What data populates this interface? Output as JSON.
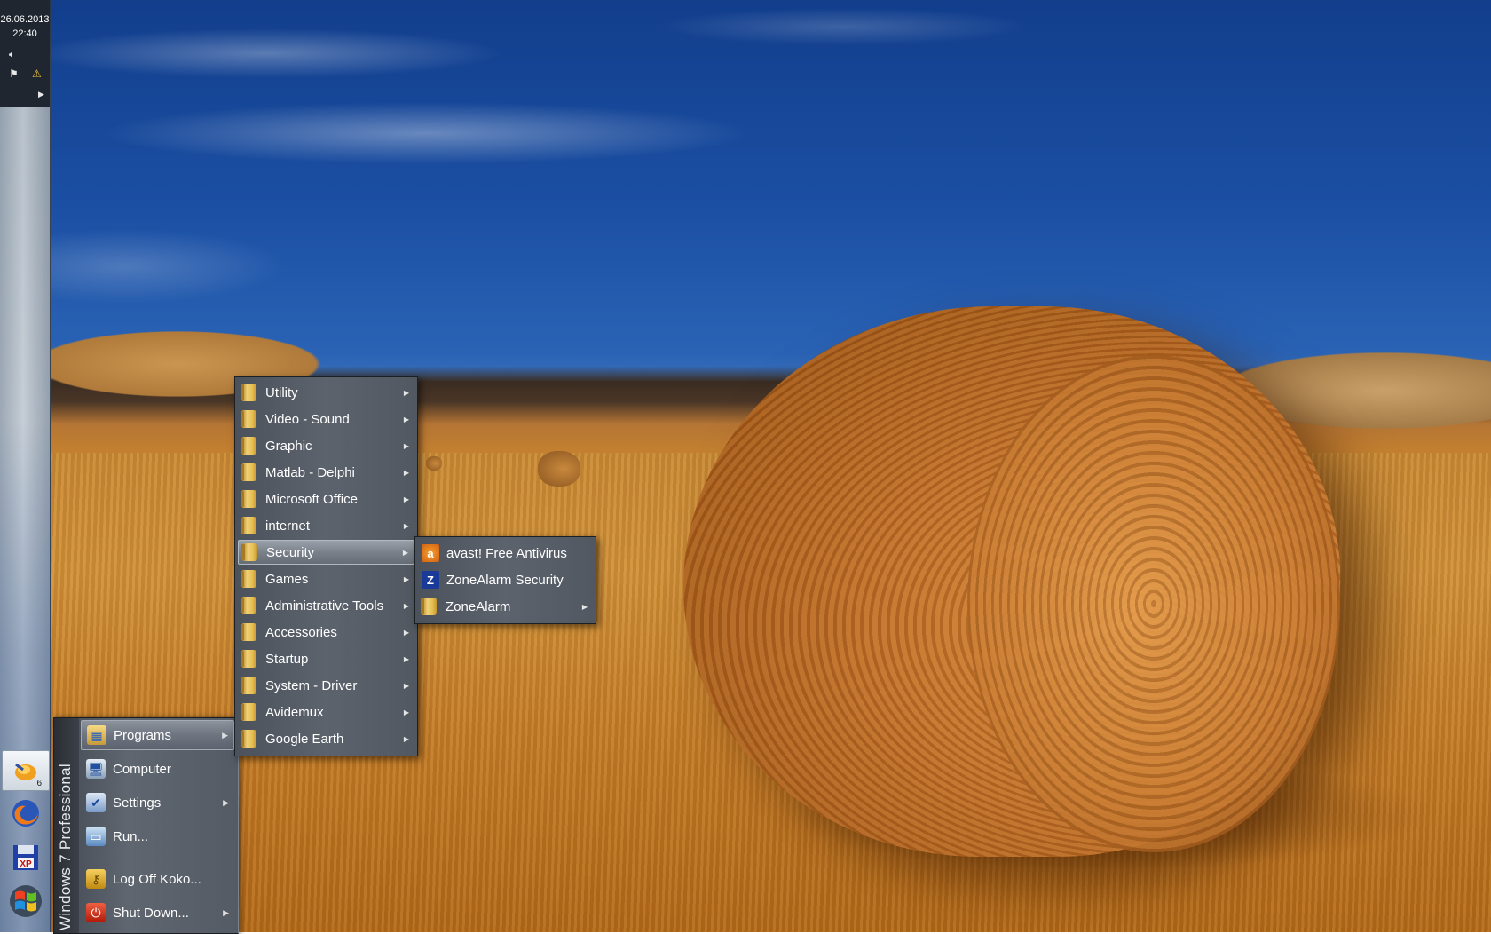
{
  "tray": {
    "date": "26.06.2013",
    "time": "22:40"
  },
  "taskbar": {
    "launcher_badge": "6",
    "buttons": [
      {
        "icon": "file-manager-icon",
        "badge": "6",
        "active": true
      },
      {
        "icon": "firefox-icon"
      },
      {
        "icon": "xp-mode-icon"
      },
      {
        "icon": "windows-logo-icon"
      }
    ]
  },
  "start_menu": {
    "brand": "Windows 7 Professional",
    "items": [
      {
        "label": "Programs",
        "icon": "programs-folder-icon",
        "has_submenu": true,
        "active": true
      },
      {
        "label": "Computer",
        "icon": "computer-icon",
        "has_submenu": false
      },
      {
        "label": "Settings",
        "icon": "settings-icon",
        "has_submenu": true
      },
      {
        "label": "Run...",
        "icon": "run-icon",
        "has_submenu": false
      },
      {
        "label": "Log Off Koko...",
        "icon": "key-icon",
        "has_submenu": false
      },
      {
        "label": "Shut Down...",
        "icon": "power-icon",
        "has_submenu": true
      }
    ]
  },
  "programs_menu": {
    "items": [
      "Utility",
      "Video - Sound",
      "Graphic",
      "Matlab - Delphi",
      "Microsoft Office",
      "internet",
      "Security",
      "Games",
      "Administrative Tools",
      "Accessories",
      "Startup",
      "System - Driver",
      "Avidemux",
      "Google Earth"
    ],
    "active": "Security"
  },
  "security_menu": {
    "items": [
      {
        "label": "avast! Free Antivirus",
        "icon": "avast-icon",
        "has_submenu": false
      },
      {
        "label": "ZoneAlarm Security",
        "icon": "zonealarm-icon",
        "has_submenu": false
      },
      {
        "label": "ZoneAlarm",
        "icon": "folder-icon",
        "has_submenu": true
      }
    ]
  },
  "colors": {
    "menu_bg": "#5c636d",
    "menu_highlight": "#8c939d",
    "tray_bg": "#1f2630",
    "sky": "#1b4fa3",
    "field": "#c98a35"
  }
}
